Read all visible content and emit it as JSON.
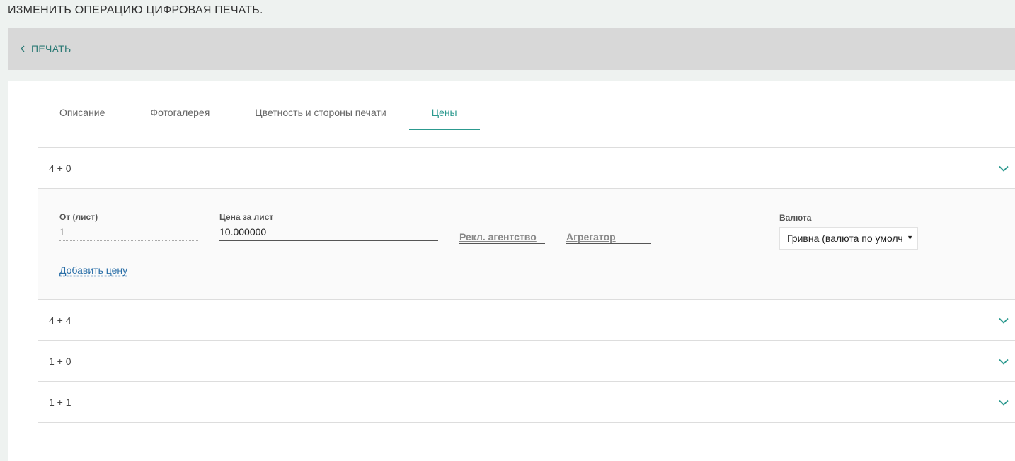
{
  "page": {
    "title": "ИЗМЕНИТЬ ОПЕРАЦИЮ ЦИФРОВАЯ ПЕЧАТЬ."
  },
  "back": {
    "label": "ПЕЧАТЬ",
    "icon": "chevron-left-icon"
  },
  "tabs": [
    {
      "label": "Описание",
      "active": false
    },
    {
      "label": "Фотогалерея",
      "active": false
    },
    {
      "label": "Цветность и стороны печати",
      "active": false
    },
    {
      "label": "Цены",
      "active": true
    }
  ],
  "accordion": {
    "sections": [
      {
        "label": "4 + 0",
        "expanded": true
      },
      {
        "label": "4 + 4",
        "expanded": false
      },
      {
        "label": "1 + 0",
        "expanded": false
      },
      {
        "label": "1 + 1",
        "expanded": false
      }
    ],
    "expanded_body": {
      "from_label": "От (лист)",
      "from_value": "1",
      "price_label": "Цена за лист",
      "price_value": "10.000000",
      "agency_label": "Рекл. агентство",
      "aggregator_label": "Агрегатор",
      "currency_label": "Валюта",
      "currency_selected": "Гривна (валюта по умолчанию)",
      "add_price_label": "Добавить цену"
    }
  },
  "colors": {
    "accent": "#2c9a8f",
    "link": "#2a6fa8",
    "back_bar": "#d8d8d8",
    "page_bg": "#eef2f0"
  }
}
